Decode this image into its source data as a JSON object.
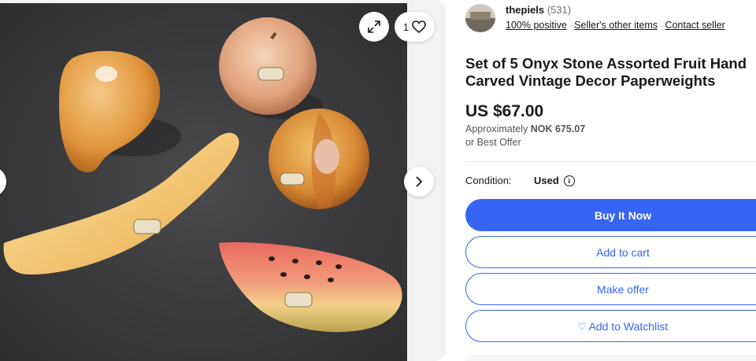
{
  "gallery": {
    "watch_count": "1"
  },
  "seller": {
    "name": "thepiels",
    "feedback_count": "(531)",
    "positive": "100% positive",
    "other_items": "Seller's other items",
    "contact": "Contact seller"
  },
  "listing": {
    "title": "Set of 5 Onyx Stone Assorted Fruit Hand Carved Vintage Decor Paperweights",
    "price": "US $67.00",
    "approx_prefix": "Approximately",
    "approx_value": "NOK 675.07",
    "best_offer": "or Best Offer",
    "condition_label": "Condition:",
    "condition_value": "Used"
  },
  "actions": {
    "buy_now": "Buy It Now",
    "add_to_cart": "Add to cart",
    "make_offer": "Make offer",
    "watchlist": "Add to Watchlist"
  },
  "colors": {
    "primary": "#3665f3",
    "text": "#191919"
  },
  "icons": [
    "expand-icon",
    "heart-icon",
    "chevron-right-icon",
    "chevron-left-icon",
    "info-icon",
    "heart-small-icon"
  ]
}
